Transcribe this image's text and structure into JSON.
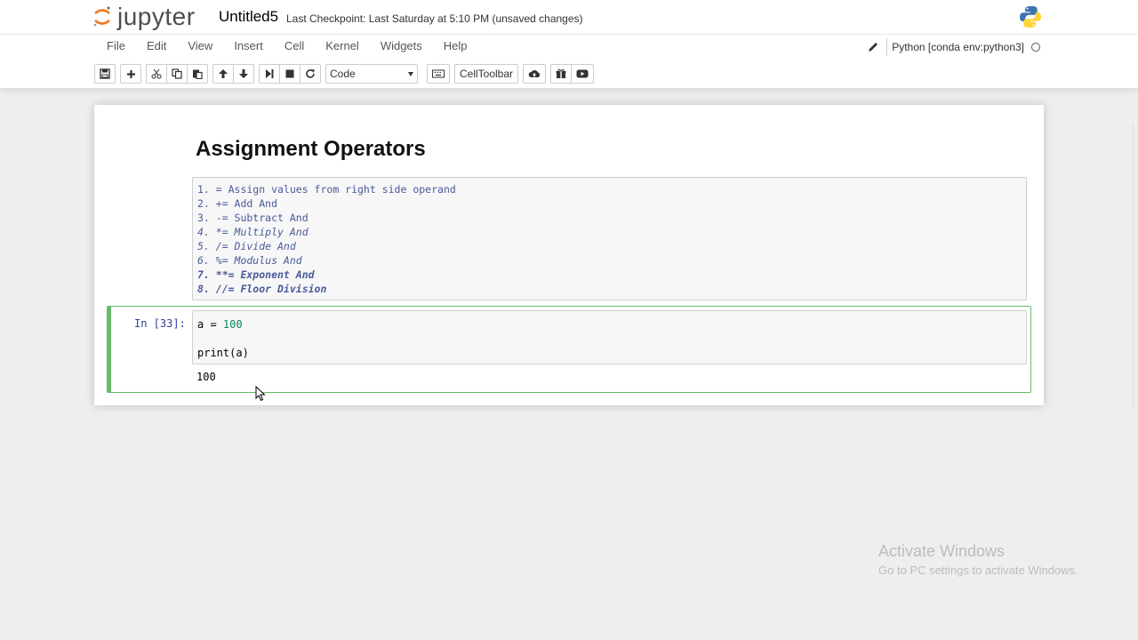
{
  "app": {
    "logo_text": "jupyter",
    "notebook_name": "Untitled5",
    "checkpoint": "Last Checkpoint: Last Saturday at 5:10 PM (unsaved changes)"
  },
  "menu": [
    "File",
    "Edit",
    "View",
    "Insert",
    "Cell",
    "Kernel",
    "Widgets",
    "Help"
  ],
  "kernel": {
    "name": "Python [conda env:python3]"
  },
  "toolbar": {
    "cell_type": "Code",
    "celltoolbar_label": "CellToolbar"
  },
  "markdown_cell": {
    "heading": "Assignment Operators",
    "lines": [
      "1. = Assign values from right side operand",
      "2. += Add And",
      "3. -= Subtract And",
      "4. *= Multiply And",
      "5. /= Divide And",
      "6. %= Modulus And",
      "7. **= Exponent And",
      "8. //= Floor Division"
    ]
  },
  "code_cell": {
    "prompt": "In [33]:",
    "line1_var": "a = ",
    "line1_num": "100",
    "line2": "print(a)",
    "output": "100"
  },
  "watermark": {
    "title": "Activate Windows",
    "subtitle": "Go to PC settings to activate Windows."
  }
}
